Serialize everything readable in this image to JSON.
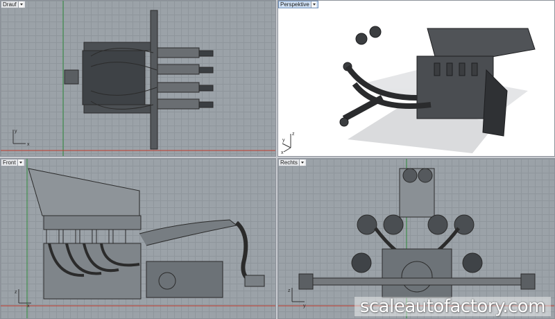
{
  "viewports": {
    "top": {
      "label": "Drauf",
      "axis_y": "y",
      "axis_x": "x"
    },
    "perspective": {
      "label": "Perspektive",
      "axis_z": "z",
      "axis_y": "y",
      "axis_x": "x"
    },
    "front": {
      "label": "Front",
      "axis_z": "z",
      "axis_x": "x"
    },
    "right": {
      "label": "Rechts",
      "axis_z": "z",
      "axis_y": "y"
    }
  },
  "watermark": "scaleautofactory.com",
  "colors": {
    "grid_bg": "#9ba2a8",
    "grid_line": "#8f969c",
    "axis_red": "#c0392b",
    "axis_green": "#2e8b3a",
    "wire": "#2b2b2b",
    "active_tab": "#cfe0f4"
  },
  "icons": {
    "dropdown": "chevron-down-icon"
  }
}
